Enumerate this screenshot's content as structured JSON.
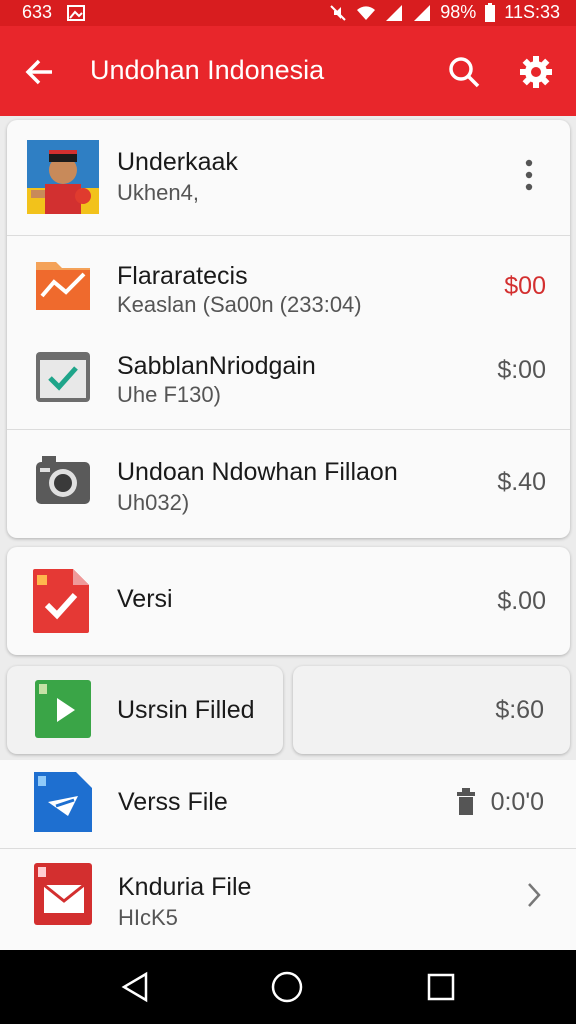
{
  "status_bar": {
    "time_left": "633",
    "battery": "98%",
    "clock": "11S:33",
    "icons": [
      "image-icon",
      "mute-icon",
      "wifi-icon",
      "signal-icon",
      "signal-icon",
      "battery-icon"
    ]
  },
  "app_bar": {
    "title": "Undohan Indonesia",
    "icons": [
      "back-arrow-icon",
      "search-icon",
      "gear-icon"
    ]
  },
  "profile": {
    "name": "Underkaak",
    "subtitle": "Ukhen4,",
    "icons": [
      "avatar",
      "more-vert-icon"
    ]
  },
  "group1": [
    {
      "name": "Flararatecis",
      "subtitle": "Keaslan (Sa00n (233:04)",
      "price": "$00",
      "price_color": "#d32f2f",
      "icon": "chart-folder-icon"
    },
    {
      "name": "SabblanNriodgain",
      "subtitle": "Uhe F130)",
      "price": "$:00",
      "icon": "checkbox-window-icon"
    },
    {
      "name": "Undoan Ndowhan Fillaon",
      "subtitle": "Uh032)",
      "price": "$.40",
      "icon": "camera-icon"
    }
  ],
  "single": {
    "name": "Versi",
    "price": "$.00",
    "icon": "red-check-file-icon"
  },
  "split": {
    "name": "Usrsin Filled",
    "price": "$:60",
    "icon": "green-file-icon"
  },
  "list": [
    {
      "name": "Verss File",
      "value": "0:0'0",
      "icon": "blue-file-icon",
      "trailing": "trash-icon"
    },
    {
      "name": "Knduria File",
      "subtitle": "HIcK5",
      "icon": "red-mail-file-icon",
      "trailing": "chevron-right-icon"
    }
  ],
  "nav_bar": {
    "icons": [
      "back-triangle-icon",
      "home-circle-icon",
      "recents-square-icon"
    ]
  },
  "colors": {
    "accent": "#e8262b",
    "status_bar": "#d81d1f",
    "price_red": "#d32f2f"
  }
}
